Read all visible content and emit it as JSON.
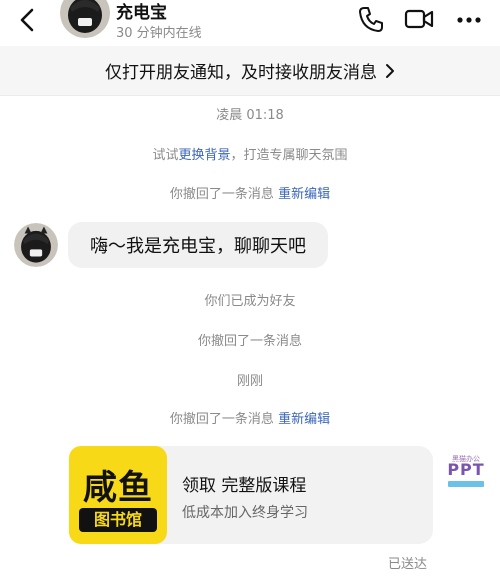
{
  "header": {
    "contact_name": "充电宝",
    "status": "30 分钟内在线",
    "icons": [
      "back-chevron-icon",
      "phone-icon",
      "video-call-icon",
      "more-icon"
    ]
  },
  "notice": {
    "text": "仅打开朋友通知，及时接收朋友消息"
  },
  "timeline": {
    "time_1": "凌晨 01:18",
    "bg_tip_prefix": "试试",
    "bg_tip_link": "更换背景",
    "bg_tip_suffix": "，打造专属聊天氛围",
    "recalled_1": "你撤回了一条消息",
    "reedit_1": "重新编辑",
    "friends_now": "你们已成为好友",
    "recalled_2": "你撤回了一条消息",
    "time_2": "刚刚",
    "recalled_3": "你撤回了一条消息",
    "reedit_2": "重新编辑"
  },
  "message": {
    "text": "嗨～我是充电宝，聊聊天吧"
  },
  "card": {
    "logo_top": "咸鱼",
    "logo_bottom": "图书馆",
    "title": "领取 完整版课程",
    "subtitle": "低成本加入终身学习"
  },
  "ppt_badge": {
    "small_text": "黑猫办公",
    "main_text": "PPT"
  },
  "delivery_status": "已送达",
  "colors": {
    "link": "#3b66b8",
    "muted": "#8a8a8a",
    "card_logo_yellow": "#f7d917",
    "bubble_bg": "#f1f1f1",
    "notice_bg": "#f6f6f6"
  }
}
